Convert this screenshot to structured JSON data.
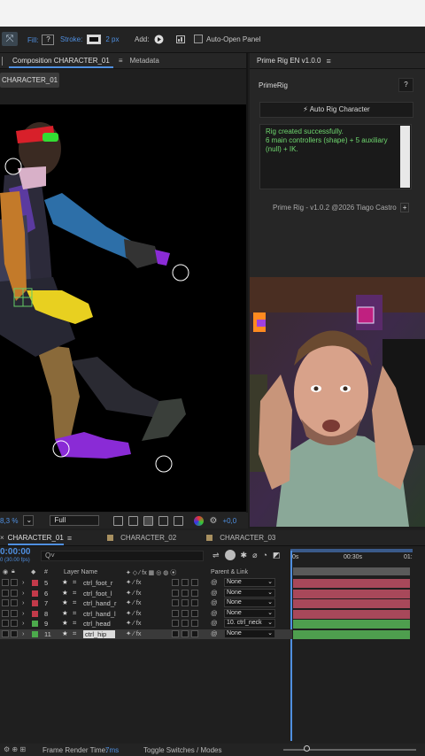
{
  "toolbar": {
    "fill_label": "Fill:",
    "fill_value": "?",
    "stroke_label": "Stroke:",
    "stroke_width": "2 px",
    "add_label": "Add:",
    "auto_open_label": "Auto-Open Panel"
  },
  "composition": {
    "tab_active": "Composition CHARACTER_01",
    "tab_metadata": "Metadata",
    "comp_chip": "CHARACTER_01",
    "zoom_value": "8,3  %",
    "resolution": "Full",
    "exposure": "+0,0"
  },
  "prime_rig": {
    "title": "Prime Rig EN v1.0.0",
    "heading": "PrimeRig",
    "help": "?",
    "auto_rig_button": "Auto Rig Character",
    "log_line1": "Rig created successfully.",
    "log_line2": "6 main controllers (shape) + 5 auxiliary (null) + IK.",
    "footer": "Prime Rig - v1.0.2 @2026 Tiago Castro",
    "footer_add": "+"
  },
  "timeline": {
    "tabs": [
      "CHARACTER_01",
      "CHARACTER_02",
      "CHARACTER_03"
    ],
    "timecode": "0:00:00",
    "timecode_sub": "0 (30.00 fps)",
    "search_placeholder": "Q˅",
    "col_number": "#",
    "col_layer_name": "Layer Name",
    "col_parent": "Parent & Link",
    "ruler_labels": [
      "0s",
      "00:30s",
      "01:"
    ],
    "layers": [
      {
        "num": "5",
        "name": "ctrl_foot_r",
        "parent": "None",
        "color": "#c23a4a",
        "track": "#a8485a"
      },
      {
        "num": "6",
        "name": "ctrl_foot_l",
        "parent": "None",
        "color": "#c23a4a",
        "track": "#a8485a"
      },
      {
        "num": "7",
        "name": "ctrl_hand_r",
        "parent": "None",
        "color": "#c23a4a",
        "track": "#a8485a"
      },
      {
        "num": "8",
        "name": "ctrl_hand_l",
        "parent": "None",
        "color": "#c23a4a",
        "track": "#a8485a"
      },
      {
        "num": "9",
        "name": "ctrl_head",
        "parent": "10. ctrl_neck",
        "color": "#4caa4c",
        "track": "#4e9e4e"
      },
      {
        "num": "11",
        "name": "ctrl_hip",
        "parent": "None",
        "color": "#4caa4c",
        "track": "#4e9e4e"
      }
    ],
    "frame_render_label": "Frame Render Time:",
    "frame_render_value": "7ms",
    "toggle_label": "Toggle Switches / Modes"
  },
  "colors": {
    "accent": "#4f8fe0",
    "log_text": "#6fd86f"
  }
}
